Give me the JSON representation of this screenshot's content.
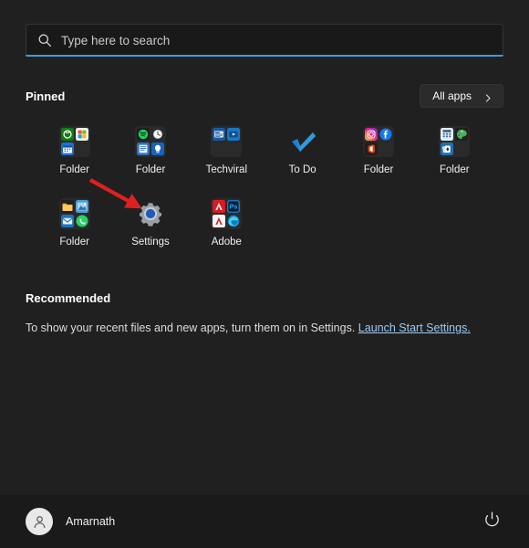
{
  "search": {
    "placeholder": "Type here to search",
    "value": "",
    "icon": "search-icon"
  },
  "pinned": {
    "title": "Pinned",
    "all_apps_label": "All apps",
    "all_apps_icon": "chevron-right-icon",
    "apps": [
      {
        "label": "Folder",
        "type": "folder",
        "icons": [
          "xbox-icon",
          "microsoft-store-icon",
          "calendar-icon",
          "empty"
        ]
      },
      {
        "label": "Folder",
        "type": "folder",
        "icons": [
          "spotify-icon",
          "clock-icon",
          "sticky-notes-icon",
          "tips-lightbulb-icon"
        ]
      },
      {
        "label": "Techviral",
        "type": "folder",
        "icons": [
          "news-app-icon",
          "media-player-icon",
          "empty",
          "empty"
        ]
      },
      {
        "label": "To Do",
        "type": "app",
        "icons": [
          "to-do-checkmark-icon"
        ]
      },
      {
        "label": "Folder",
        "type": "folder",
        "icons": [
          "instagram-icon",
          "facebook-icon",
          "office-icon",
          "empty"
        ]
      },
      {
        "label": "Folder",
        "type": "folder",
        "icons": [
          "calculator-icon",
          "paint-icon",
          "solitaire-icon",
          "empty"
        ]
      },
      {
        "label": "Folder",
        "type": "folder",
        "icons": [
          "file-explorer-icon",
          "photos-icon",
          "mail-icon",
          "whatsapp-icon"
        ]
      },
      {
        "label": "Settings",
        "type": "app",
        "icons": [
          "settings-gear-icon"
        ]
      },
      {
        "label": "Adobe",
        "type": "folder",
        "icons": [
          "adobe-acrobat-icon",
          "photoshop-icon",
          "adobe-reader-icon",
          "edge-icon"
        ]
      }
    ]
  },
  "recommended": {
    "title": "Recommended",
    "empty_text": "To show your recent files and new apps, turn them on in Settings.",
    "link_label": "Launch Start Settings."
  },
  "footer": {
    "user_name": "Amarnath",
    "avatar_icon": "user-avatar-icon",
    "power_icon": "power-icon"
  },
  "annotation": {
    "arrow_color": "#e02020",
    "points_at": "Settings"
  },
  "colors": {
    "background": "#202020",
    "footer_background": "#1a1a1a",
    "search_background": "#191919",
    "accent": "#3a9fd8",
    "link": "#9ecbf0",
    "arrow": "#e02020"
  }
}
